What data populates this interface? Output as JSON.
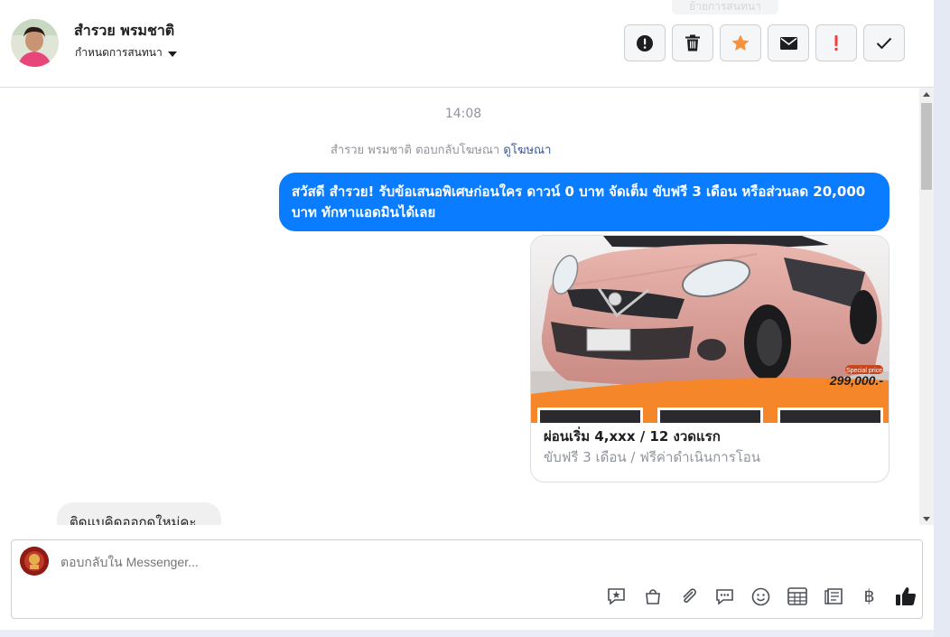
{
  "header": {
    "contact_name": "สำรวย พรมชาติ",
    "settings_label": "กำหนดการสนทนา",
    "tooltip_ghost": "ย้ายการสนทนา",
    "toolbar": [
      {
        "name": "report-button",
        "icon": "exclamation-circle-icon"
      },
      {
        "name": "delete-button",
        "icon": "trash-icon"
      },
      {
        "name": "star-button",
        "icon": "star-icon"
      },
      {
        "name": "mark-unread-button",
        "icon": "envelope-icon"
      },
      {
        "name": "flag-button",
        "icon": "exclamation-icon"
      },
      {
        "name": "done-button",
        "icon": "check-icon"
      }
    ],
    "colors": {
      "star": "#f7923a",
      "flag": "#fa3e3e"
    }
  },
  "conversation": {
    "time": "14:08",
    "ad_reply_text": "สำรวย พรมชาติ ตอบกลับโฆษณา",
    "ad_link": "ดูโฆษณา",
    "outgoing_message": "สวัสดี สำรวย! รับข้อเสนอพิเศษก่อนใคร ดาวน์ 0 บาท จัดเต็ม ขับฟรี 3 เดือน หรือส่วนลด 20,000 บาท ทักหาแอดมินได้เลย",
    "card": {
      "title": "ผ่อนเริ่ม 4,xxx / 12 งวดแรก",
      "subtitle": "ขับฟรี 3 เดือน / ฟรีค่าดำเนินการโอน",
      "badge_label": "Special price",
      "price": "299,000.-"
    },
    "incoming_message": "ติดแบคิดออกดใหม่คะ"
  },
  "composer": {
    "placeholder": "ตอบกลับใน Messenger...",
    "tools": [
      "quick-reply-icon",
      "shopping-bag-icon",
      "paperclip-icon",
      "saved-reply-icon",
      "emoji-icon",
      "table-icon",
      "notes-icon",
      "baht-icon",
      "like-icon"
    ],
    "baht_glyph": "฿"
  },
  "accent_color": "#0a7cff"
}
